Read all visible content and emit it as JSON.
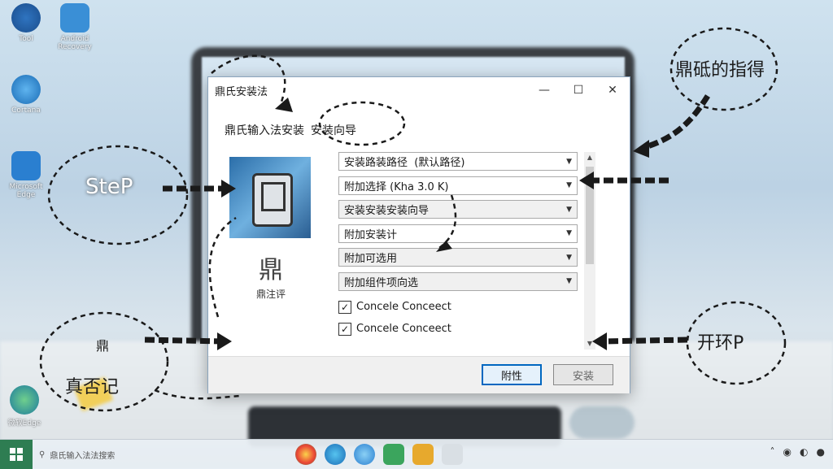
{
  "desktop": {
    "icons": [
      {
        "label": "Tool"
      },
      {
        "label": "Android\nRecovery"
      },
      {
        "label": "Cortana"
      },
      {
        "label": "Microsoft\nEdge"
      },
      {
        "label": "微软Edge"
      }
    ]
  },
  "dialog": {
    "title": "鼎氏安装法",
    "header_left": "鼎氏输入法安装",
    "header_right": "安装向导",
    "app_char": "鼎",
    "app_sub": "鼎注评",
    "selects": [
      {
        "label": "安装路装路径",
        "extra": "(默认路径)"
      },
      {
        "label": "附加选择 (Kha 3.0 K)",
        "extra": ""
      },
      {
        "label": "安装安装安装向导",
        "extra": ""
      },
      {
        "label": "附加安装计",
        "extra": ""
      },
      {
        "label": "附加可选用",
        "extra": ""
      },
      {
        "label": "附加组件项向选",
        "extra": ""
      }
    ],
    "checkboxes": [
      {
        "label": "Concele Conceect",
        "checked": true
      },
      {
        "label": "Concele Conceect",
        "checked": true
      }
    ],
    "buttons": {
      "primary": "附性",
      "secondary": "安装"
    }
  },
  "annotations": {
    "step": "SteP",
    "top_right": "鼎砥的指得",
    "bottom_left": "真否记",
    "bottom_left_small": "鼎",
    "right": "开环P"
  },
  "taskbar": {
    "search_placeholder": "鼎氏输入法法搜索"
  }
}
